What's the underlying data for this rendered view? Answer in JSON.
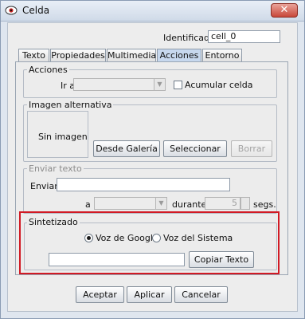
{
  "window": {
    "title": "Celda",
    "close_glyph": "✕"
  },
  "identifier": {
    "label": "Identificador",
    "value": "cell_0"
  },
  "tabs": [
    {
      "label": "Texto"
    },
    {
      "label": "Propiedades"
    },
    {
      "label": "Multimedia"
    },
    {
      "label": "Acciones"
    },
    {
      "label": "Entorno"
    }
  ],
  "active_tab": "Acciones",
  "acciones": {
    "group_title": "Acciones",
    "ir_a_label": "Ir a",
    "ir_a_value": "",
    "acumular_label": "Acumular celda",
    "acumular_checked": false
  },
  "imagen": {
    "group_title": "Imagen alternativa",
    "placeholder": "Sin imagen",
    "buttons": {
      "galeria": "Desde Galería",
      "seleccionar": "Seleccionar",
      "borrar": "Borrar"
    }
  },
  "enviar": {
    "group_title": "Enviar texto",
    "enviar_label": "Enviar",
    "enviar_value": "",
    "a_label": "a",
    "durante_label": "durante",
    "segundos_value": "5",
    "segs_label": "segs."
  },
  "sintetizado": {
    "group_title": "Sintetizado",
    "radio_google": "Voz de Google",
    "radio_sistema": "Voz del Sistema",
    "selected": "Voz de Google",
    "text_value": "",
    "copy_button": "Copiar Texto"
  },
  "footer": {
    "accept": "Aceptar",
    "apply": "Aplicar",
    "cancel": "Cancelar"
  },
  "colors": {
    "highlight": "#d11a24",
    "active_tab": "#c7d8ee"
  }
}
